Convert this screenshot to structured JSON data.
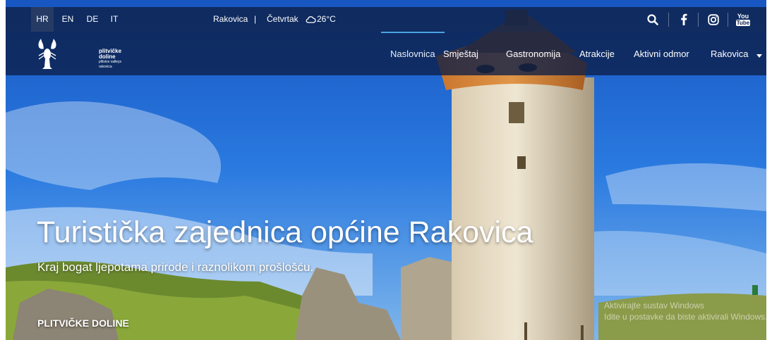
{
  "topbar": {
    "languages": [
      {
        "code": "HR",
        "active": true
      },
      {
        "code": "EN",
        "active": false
      },
      {
        "code": "DE",
        "active": false
      },
      {
        "code": "IT",
        "active": false
      }
    ],
    "location": "Rakovica",
    "separator": "|",
    "weather_day": "Četvrtak",
    "weather_temp": "26°C",
    "weather_icon": "cloud-sun-icon",
    "icons": [
      "search-icon",
      "facebook-icon",
      "instagram-icon",
      "youtube-icon"
    ],
    "youtube_top": "You",
    "youtube_bottom": "Tube"
  },
  "logo": {
    "line1": "plitvičke",
    "line2": "doline",
    "line3": "plitvice valleys",
    "line4": "rakovica"
  },
  "nav": {
    "items": [
      {
        "label": "Naslovnica",
        "active": true
      },
      {
        "label": "Smještaj",
        "active": false
      },
      {
        "label": "Gastronomija",
        "active": false
      },
      {
        "label": "Atrakcije",
        "active": false
      },
      {
        "label": "Aktivni odmor",
        "active": false
      },
      {
        "label": "Rakovica",
        "active": false
      }
    ],
    "dropdown_icon": "caret-down-icon"
  },
  "hero": {
    "title": "Turistička zajednica općine Rakovica",
    "subtitle": "Kraj bogat ljepotama prirode i raznolikom prošlošću.",
    "tag": "PLITVIČKE DOLINE"
  },
  "watermark": {
    "line1": "Aktivirajte sustav Windows",
    "line2": "Idite u postavke da biste aktivirali Windows."
  },
  "colors": {
    "topbar": "#0e234e",
    "navbar": "#0c1e46",
    "accent": "#4ba3e3",
    "sky": "#1f6fd6"
  }
}
